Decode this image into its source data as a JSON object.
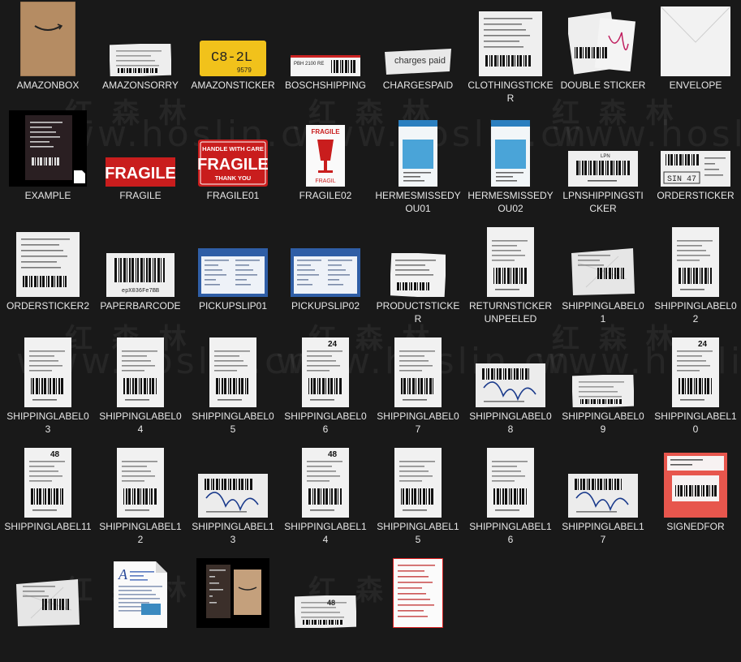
{
  "window": {
    "title": ""
  },
  "files": [
    {
      "name": "AMAZONBOX",
      "kind": "box"
    },
    {
      "name": "AMAZONSORRY",
      "kind": "wide-label"
    },
    {
      "name": "AMAZONSTICKER",
      "kind": "yellow-sticker",
      "text": "C8-2L",
      "sub": "9579"
    },
    {
      "name": "BOSCHSHIPPING",
      "kind": "wide-barcode",
      "text": "PBH 2100 RE"
    },
    {
      "name": "CHARGESPAID",
      "kind": "torn-label",
      "text": "charges paid"
    },
    {
      "name": "CLOTHINGSTICKER",
      "kind": "white-label"
    },
    {
      "name": "DOUBLE STICKER",
      "kind": "double"
    },
    {
      "name": "ENVELOPE",
      "kind": "envelope"
    },
    {
      "name": "EXAMPLE",
      "kind": "dark-file"
    },
    {
      "name": "FRAGILE",
      "kind": "red-fragile",
      "text": "FRAGILE"
    },
    {
      "name": "FRAGILE01",
      "kind": "red-fragile-card",
      "top": "HANDLE WITH CARE",
      "text": "FRAGILE",
      "bottom": "THANK YOU"
    },
    {
      "name": "FRAGILE02",
      "kind": "glass",
      "text": "FRAGILE",
      "sub": "FRAGIL"
    },
    {
      "name": "HERMESMISSEDYOU01",
      "kind": "tall-blue"
    },
    {
      "name": "HERMESMISSEDYOU02",
      "kind": "tall-blue"
    },
    {
      "name": "LPNSHIPPINGSTICKER",
      "kind": "wide-barcode-big",
      "text": "LPN"
    },
    {
      "name": "ORDERSTICKER",
      "kind": "order",
      "text": "SIN 47"
    },
    {
      "name": "ORDERSTICKER2",
      "kind": "white-label"
    },
    {
      "name": "PAPERBARCODE",
      "kind": "barcode-paper",
      "text": "epX036Fe7BB"
    },
    {
      "name": "PICKUPSLIP01",
      "kind": "blue-slip"
    },
    {
      "name": "PICKUPSLIP02",
      "kind": "blue-slip"
    },
    {
      "name": "PRODUCTSTICKER",
      "kind": "product"
    },
    {
      "name": "RETURNSTICKER UNPEELED",
      "kind": "tall-white"
    },
    {
      "name": "SHIPPINGLABEL01",
      "kind": "crumpled"
    },
    {
      "name": "SHIPPINGLABEL02",
      "kind": "tall-white"
    },
    {
      "name": "SHIPPINGLABEL03",
      "kind": "tall-white"
    },
    {
      "name": "SHIPPINGLABEL04",
      "kind": "tall-white"
    },
    {
      "name": "SHIPPINGLABEL05",
      "kind": "tall-white"
    },
    {
      "name": "SHIPPINGLABEL06",
      "kind": "tall-white",
      "badge": "24"
    },
    {
      "name": "SHIPPINGLABEL07",
      "kind": "tall-white"
    },
    {
      "name": "SHIPPINGLABEL08",
      "kind": "scribble"
    },
    {
      "name": "SHIPPINGLABEL09",
      "kind": "wide-label"
    },
    {
      "name": "SHIPPINGLABEL10",
      "kind": "tall-white",
      "badge": "24"
    },
    {
      "name": "SHIPPINGLABEL11",
      "kind": "tall-white",
      "badge": "48"
    },
    {
      "name": "SHIPPINGLABEL12",
      "kind": "tall-white"
    },
    {
      "name": "SHIPPINGLABEL13",
      "kind": "scribble"
    },
    {
      "name": "SHIPPINGLABEL14",
      "kind": "tall-white",
      "badge": "48"
    },
    {
      "name": "SHIPPINGLABEL15",
      "kind": "tall-white"
    },
    {
      "name": "SHIPPINGLABEL16",
      "kind": "tall-white"
    },
    {
      "name": "SHIPPINGLABEL17",
      "kind": "scribble"
    },
    {
      "name": "SIGNEDFOR",
      "kind": "signed"
    },
    {
      "name": "",
      "kind": "crumpled"
    },
    {
      "name": "",
      "kind": "document"
    },
    {
      "name": "",
      "kind": "dark-box"
    },
    {
      "name": "",
      "kind": "wide-label",
      "badge": "48"
    },
    {
      "name": "",
      "kind": "red-doc"
    }
  ],
  "watermark": {
    "cn": "红  森  林",
    "en": "www.hoslin.cn"
  }
}
